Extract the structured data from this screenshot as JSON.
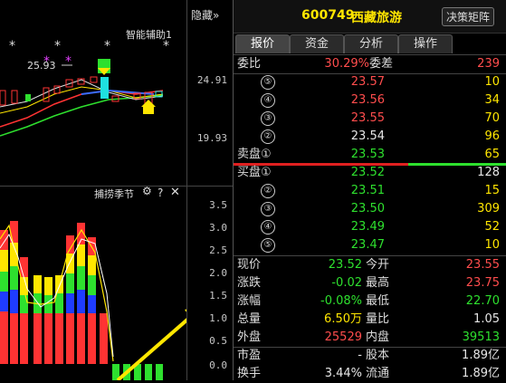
{
  "left_panel": {
    "hide_button": "隐藏",
    "hide_chevron": "»",
    "indicator_main": "智能辅助1",
    "price_label": "25.93",
    "price_axis_top": [
      "24.91",
      "19.93"
    ],
    "indicator_sub": "捕捞季节",
    "sub_axis": [
      "3.5",
      "3.0",
      "2.5",
      "2.0",
      "1.5",
      "1.0",
      "0.5",
      "0.0"
    ]
  },
  "header": {
    "code": "600749",
    "name": "西藏旅游",
    "matrix_button": "决策矩阵"
  },
  "tabs": [
    "报价",
    "资金",
    "分析",
    "操作"
  ],
  "order_book": {
    "ratio_label": "委比",
    "ratio_value": "30.29%",
    "diff_label": "委差",
    "diff_value": "239",
    "sells": [
      {
        "level": "⑤",
        "price": "23.57",
        "vol": "10"
      },
      {
        "level": "④",
        "price": "23.56",
        "vol": "34"
      },
      {
        "level": "③",
        "price": "23.55",
        "vol": "70"
      },
      {
        "level": "②",
        "price": "23.54",
        "vol": "96"
      }
    ],
    "sell1": {
      "label": "卖盘①",
      "price": "23.53",
      "vol": "65"
    },
    "buy1": {
      "label": "买盘①",
      "price": "23.52",
      "vol": "128"
    },
    "buys": [
      {
        "level": "②",
        "price": "23.51",
        "vol": "15"
      },
      {
        "level": "③",
        "price": "23.50",
        "vol": "309"
      },
      {
        "level": "④",
        "price": "23.49",
        "vol": "52"
      },
      {
        "level": "⑤",
        "price": "23.47",
        "vol": "10"
      }
    ]
  },
  "quote": {
    "rows": [
      {
        "l1": "现价",
        "v1": "23.52",
        "l2": "今开",
        "v2": "23.55"
      },
      {
        "l1": "涨跌",
        "v1": "-0.02",
        "l2": "最高",
        "v2": "23.75"
      },
      {
        "l1": "涨幅",
        "v1": "-0.08%",
        "l2": "最低",
        "v2": "22.70"
      },
      {
        "l1": "总量",
        "v1": "6.50万",
        "l2": "量比",
        "v2": "1.05"
      },
      {
        "l1": "外盘",
        "v1": "25529",
        "l2": "内盘",
        "v2": "39513"
      },
      {
        "l1": "市盈",
        "v1": "-",
        "l2": "股本",
        "v2": "1.89亿"
      },
      {
        "l1": "换手",
        "v1": "3.44%",
        "l2": "流通",
        "v2": "1.89亿"
      }
    ]
  },
  "colors": {
    "up": "#ff4d4d",
    "down": "#2ee02e",
    "flat": "#e6e6e6",
    "accent": "#ffe600"
  }
}
